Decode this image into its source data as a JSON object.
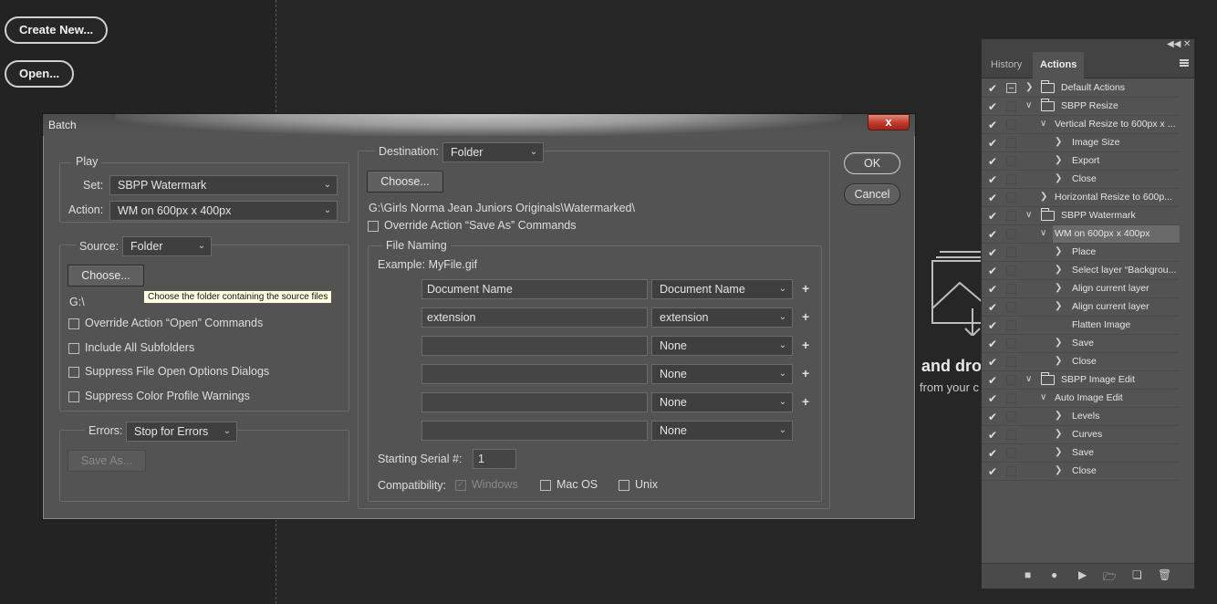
{
  "background": {
    "create_new_label": "Create New...",
    "open_label": "Open...",
    "drop_text_main": "and dro",
    "drop_text_sub": "from your c"
  },
  "dialog": {
    "title": "Batch",
    "close_glyph": "x",
    "play": {
      "group_label": "Play",
      "set_label": "Set:",
      "set_value": "SBPP Watermark",
      "action_label": "Action:",
      "action_value": "WM on 600px x 400px"
    },
    "source": {
      "label": "Source:",
      "value": "Folder",
      "choose_label": "Choose...",
      "path": "G:\\",
      "tooltip": "Choose the folder containing the source files",
      "options": [
        {
          "label": "Override Action “Open” Commands",
          "checked": false
        },
        {
          "label": "Include All Subfolders",
          "checked": false
        },
        {
          "label": "Suppress File Open Options Dialogs",
          "checked": false
        },
        {
          "label": "Suppress Color Profile Warnings",
          "checked": false
        }
      ]
    },
    "errors": {
      "label": "Errors:",
      "value": "Stop for Errors",
      "save_as_label": "Save As..."
    },
    "destination": {
      "label": "Destination:",
      "value": "Folder",
      "choose_label": "Choose...",
      "path": "G:\\Girls Norma Jean Juniors Originals\\Watermarked\\",
      "override_label": "Override Action “Save As” Commands"
    },
    "file_naming": {
      "group_label": "File Naming",
      "example": "Example: MyFile.gif",
      "rows": [
        {
          "text": "Document Name",
          "select": "Document Name",
          "plus": "+"
        },
        {
          "text": "extension",
          "select": "extension",
          "plus": "+"
        },
        {
          "text": "",
          "select": "None",
          "plus": "+"
        },
        {
          "text": "",
          "select": "None",
          "plus": "+"
        },
        {
          "text": "",
          "select": "None",
          "plus": "+"
        },
        {
          "text": "",
          "select": "None",
          "plus": ""
        }
      ],
      "serial_label": "Starting Serial #:",
      "serial_value": "1",
      "compat_label": "Compatibility:",
      "compat_windows": "Windows",
      "compat_mac": "Mac OS",
      "compat_unix": "Unix"
    },
    "ok_label": "OK",
    "cancel_label": "Cancel"
  },
  "panel": {
    "tab_history": "History",
    "tab_actions": "Actions",
    "items": [
      {
        "label": "Default Actions",
        "level": 0,
        "type": "set",
        "expanded": false,
        "dialog": true
      },
      {
        "label": "SBPP Resize",
        "level": 0,
        "type": "set",
        "expanded": true,
        "dialog": false
      },
      {
        "label": "Vertical Resize to 600px x ...",
        "level": 1,
        "type": "action",
        "expanded": true,
        "dialog": false
      },
      {
        "label": "Image Size",
        "level": 2,
        "type": "step",
        "expanded": false,
        "dialog": false
      },
      {
        "label": "Export",
        "level": 2,
        "type": "step",
        "expanded": false,
        "dialog": false
      },
      {
        "label": "Close",
        "level": 2,
        "type": "step",
        "expanded": false,
        "dialog": false
      },
      {
        "label": "Horizontal Resize to 600p...",
        "level": 1,
        "type": "action",
        "expanded": false,
        "dialog": false
      },
      {
        "label": "SBPP Watermark",
        "level": 0,
        "type": "set",
        "expanded": true,
        "dialog": false
      },
      {
        "label": "WM on 600px x 400px",
        "level": 1,
        "type": "action",
        "expanded": true,
        "dialog": false,
        "selected": true
      },
      {
        "label": "Place",
        "level": 2,
        "type": "step",
        "expanded": false,
        "dialog": false
      },
      {
        "label": "Select layer “Backgrou...",
        "level": 2,
        "type": "step",
        "expanded": false,
        "dialog": false
      },
      {
        "label": "Align current layer",
        "level": 2,
        "type": "step",
        "expanded": false,
        "dialog": false
      },
      {
        "label": "Align current layer",
        "level": 2,
        "type": "step",
        "expanded": false,
        "dialog": false
      },
      {
        "label": "Flatten Image",
        "level": 2,
        "type": "step",
        "noarrow": true,
        "dialog": false
      },
      {
        "label": "Save",
        "level": 2,
        "type": "step",
        "expanded": false,
        "dialog": false
      },
      {
        "label": "Close",
        "level": 2,
        "type": "step",
        "expanded": false,
        "dialog": false
      },
      {
        "label": "SBPP Image Edit",
        "level": 0,
        "type": "set",
        "expanded": true,
        "dialog": false
      },
      {
        "label": "Auto Image Edit",
        "level": 1,
        "type": "action",
        "expanded": true,
        "dialog": false
      },
      {
        "label": "Levels",
        "level": 2,
        "type": "step",
        "expanded": false,
        "dialog": false
      },
      {
        "label": "Curves",
        "level": 2,
        "type": "step",
        "expanded": false,
        "dialog": false
      },
      {
        "label": "Save",
        "level": 2,
        "type": "step",
        "expanded": false,
        "dialog": false
      },
      {
        "label": "Close",
        "level": 2,
        "type": "step",
        "expanded": false,
        "dialog": false
      }
    ],
    "bottom_icons": [
      "stop-icon",
      "record-icon",
      "play-icon",
      "new-set-icon",
      "new-action-icon",
      "delete-icon"
    ]
  }
}
